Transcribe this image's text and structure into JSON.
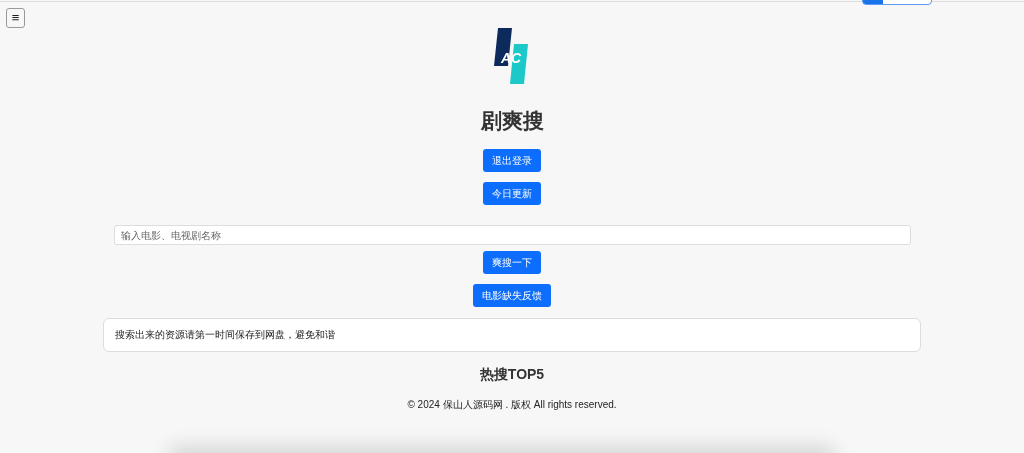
{
  "menu_button": {
    "label": "≡"
  },
  "logo": {
    "text": "AC"
  },
  "title": "剧爽搜",
  "top_buttons": [
    "退出登录",
    "今日更新"
  ],
  "search": {
    "placeholder": "输入电影、电视剧名称"
  },
  "action_buttons": [
    "爽搜一下",
    "电影缺失反馈"
  ],
  "notice": "搜索出来的资源请第一时间保存到网盘，避免和谐",
  "hot_title": "热搜TOP5",
  "footer": "© 2024 保山人源码网 . 版权 All rights reserved."
}
